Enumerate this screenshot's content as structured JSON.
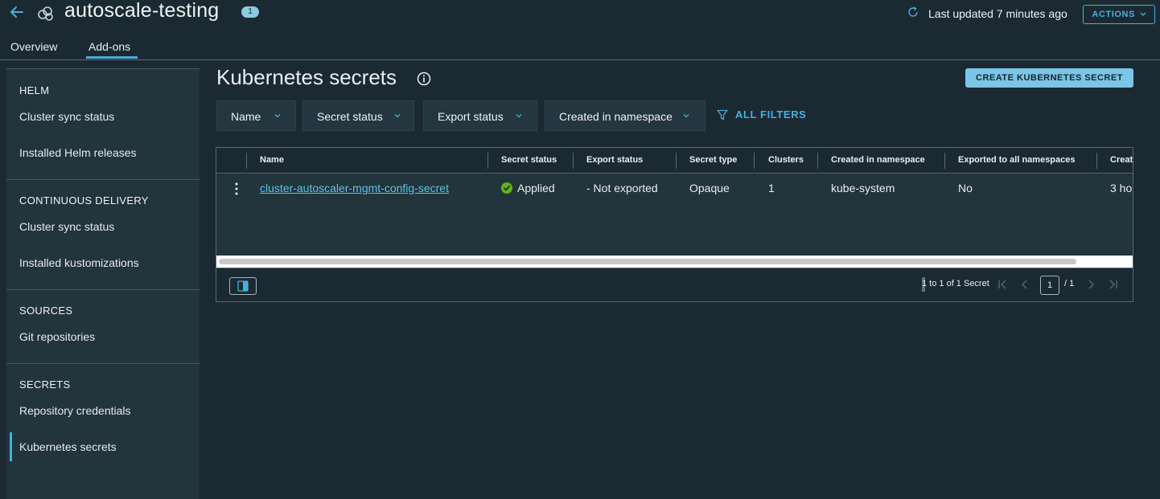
{
  "header": {
    "title": "autoscale-testing",
    "badge": "1",
    "last_updated": "Last updated 7 minutes ago",
    "actions_label": "ACTIONS",
    "tabs": [
      {
        "label": "Overview",
        "active": false
      },
      {
        "label": "Add-ons",
        "active": true
      }
    ]
  },
  "sidebar": {
    "sections": [
      {
        "heading": "HELM",
        "items": [
          "Cluster sync status",
          "Installed Helm releases"
        ]
      },
      {
        "heading": "CONTINUOUS DELIVERY",
        "items": [
          "Cluster sync status",
          "Installed kustomizations"
        ]
      },
      {
        "heading": "SOURCES",
        "items": [
          "Git repositories"
        ]
      },
      {
        "heading": "SECRETS",
        "items": [
          "Repository credentials",
          "Kubernetes secrets"
        ]
      }
    ],
    "active_item": "Kubernetes secrets"
  },
  "main": {
    "title": "Kubernetes secrets",
    "create_button": "CREATE KUBERNETES SECRET",
    "filters": [
      "Name",
      "Secret status",
      "Export status",
      "Created in namespace"
    ],
    "all_filters": "ALL FILTERS"
  },
  "grid": {
    "columns": [
      "Name",
      "Secret status",
      "Export status",
      "Secret type",
      "Clusters",
      "Created in namespace",
      "Exported to all namespaces",
      "Creat"
    ],
    "rows": [
      {
        "name": "cluster-autoscaler-mgmt-config-secret",
        "secret_status": "Applied",
        "export_status": "- Not exported",
        "secret_type": "Opaque",
        "clusters": "1",
        "namespace": "kube-system",
        "exported_all": "No",
        "created": "3 ho"
      }
    ],
    "footer": {
      "range": "1 to 1 of 1 Secret",
      "page": "1",
      "total_pages": "/ 1"
    }
  },
  "colors": {
    "background": "#1b2a32",
    "sidebar": "#22343c",
    "accent": "#49afd9",
    "primary_button": "#79c6e6",
    "success": "#5eb715"
  }
}
